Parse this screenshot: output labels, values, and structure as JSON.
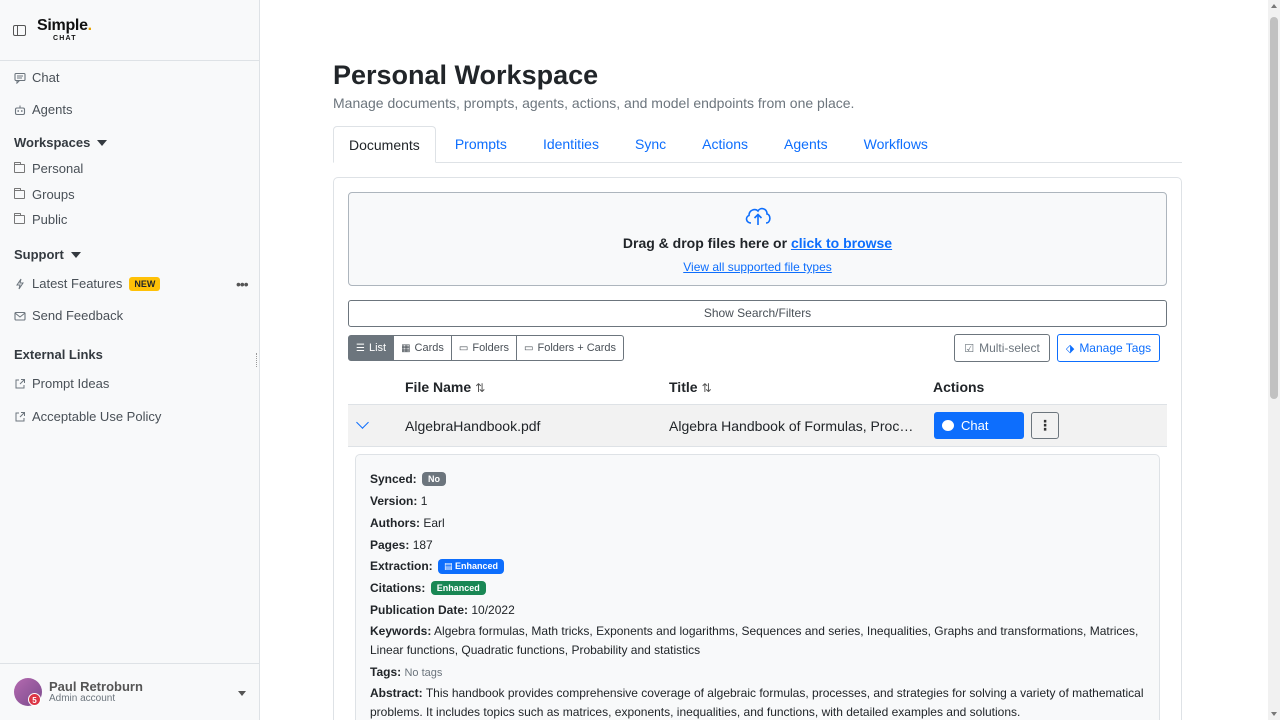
{
  "sidebar": {
    "logo_main": "Simple",
    "logo_dot": ".",
    "logo_sub": "CHAT",
    "nav": {
      "chat": "Chat",
      "agents": "Agents"
    },
    "workspaces_heading": "Workspaces",
    "workspaces": {
      "personal": "Personal",
      "groups": "Groups",
      "public": "Public"
    },
    "support_heading": "Support",
    "support": {
      "latest_features": "Latest Features",
      "new_badge": "NEW",
      "send_feedback": "Send Feedback"
    },
    "external_heading": "External Links",
    "external": {
      "prompt_ideas": "Prompt Ideas",
      "acceptable_use": "Acceptable Use Policy"
    },
    "user": {
      "name": "Paul Retroburn",
      "role": "Admin account",
      "badge": "5"
    }
  },
  "page": {
    "title": "Personal Workspace",
    "subtitle": "Manage documents, prompts, agents, actions, and model endpoints from one place."
  },
  "tabs": [
    "Documents",
    "Prompts",
    "Identities",
    "Sync",
    "Actions",
    "Agents",
    "Workflows"
  ],
  "active_tab": "Documents",
  "dropzone": {
    "text": "Drag & drop files here or ",
    "browse": "click to browse",
    "link": "View all supported file types"
  },
  "toolbar": {
    "search_filters": "Show Search/Filters",
    "views": [
      "List",
      "Cards",
      "Folders",
      "Folders + Cards"
    ],
    "active_view": "List",
    "multi_select": "Multi-select",
    "manage_tags": "Manage Tags"
  },
  "table": {
    "headers": {
      "file_name": "File Name",
      "title": "Title",
      "actions": "Actions"
    },
    "row": {
      "file_name": "AlgebraHandbook.pdf",
      "title": "Algebra Handbook of Formulas, Processes, and Strategies",
      "chat_label": "Chat",
      "more": "⋮"
    }
  },
  "details": {
    "synced_label": "Synced:",
    "synced": "No",
    "version_label": "Version:",
    "version": "1",
    "authors_label": "Authors:",
    "authors": "Earl",
    "pages_label": "Pages:",
    "pages": "187",
    "extraction_label": "Extraction:",
    "extraction": "Enhanced",
    "citations_label": "Citations:",
    "citations": "Enhanced",
    "pubdate_label": "Publication Date:",
    "pubdate": "10/2022",
    "keywords_label": "Keywords:",
    "keywords": "Algebra formulas, Math tricks, Exponents and logarithms, Sequences and series, Inequalities, Graphs and transformations, Matrices, Linear functions, Quadratic functions, Probability and statistics",
    "tags_label": "Tags:",
    "tags": "No tags",
    "abstract_label": "Abstract:",
    "abstract": "This handbook provides comprehensive coverage of algebraic formulas, processes, and strategies for solving a variety of mathematical problems. It includes topics such as matrices, exponents, inequalities, and functions, with detailed examples and solutions."
  },
  "colors": {
    "primary": "#0d6efd",
    "secondary": "#6c757d",
    "success": "#198754",
    "warning": "#ffc107"
  }
}
